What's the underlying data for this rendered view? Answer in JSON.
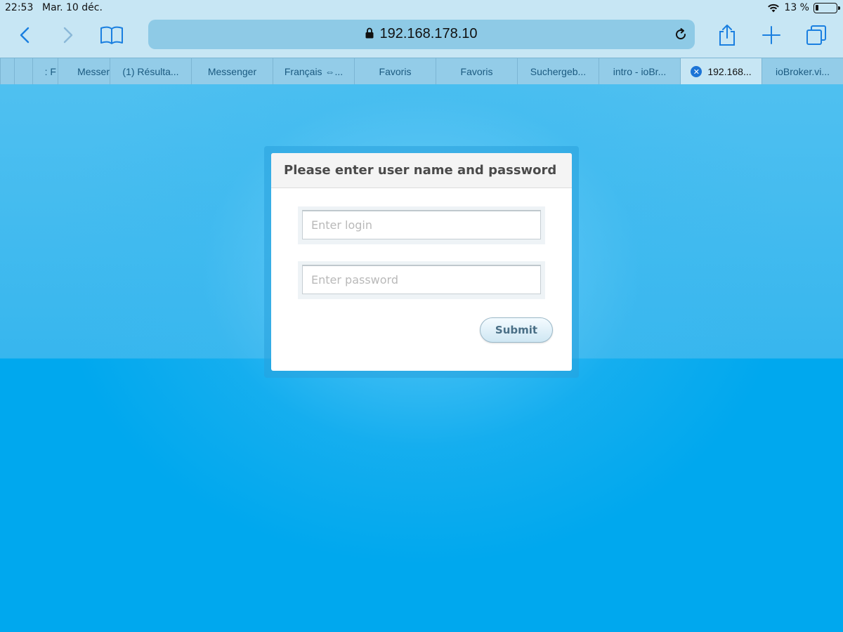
{
  "status_bar": {
    "time": "22:53",
    "date": "Mar. 10 déc.",
    "battery_percent": "13 %",
    "icons": [
      "wifi-icon",
      "battery-icon"
    ]
  },
  "toolbar": {
    "url": "192.168.178.10",
    "icons": [
      "back-arrow-icon",
      "forward-arrow-icon",
      "book-icon",
      "lock-icon",
      "reload-icon",
      "share-icon",
      "plus-icon",
      "tabs-icon"
    ]
  },
  "tabs": [
    {
      "label": ""
    },
    {
      "label": ""
    },
    {
      "label": ": F"
    },
    {
      "label": "Messer"
    },
    {
      "label": "(1) Résulta..."
    },
    {
      "label": "Messenger"
    },
    {
      "label": "Français ⇔..."
    },
    {
      "label": "Favoris"
    },
    {
      "label": "Favoris"
    },
    {
      "label": "Suchergeb..."
    },
    {
      "label": "intro - ioBr..."
    },
    {
      "label": "192.168...",
      "active": true
    },
    {
      "label": "ioBroker.vi..."
    }
  ],
  "login": {
    "title": "Please enter user name and password",
    "login_placeholder": "Enter login",
    "password_placeholder": "Enter password",
    "submit_label": "Submit"
  },
  "colors": {
    "page_background": "#00a8ee",
    "chrome_background": "#c7e6f4",
    "accent": "#1c74d6"
  }
}
